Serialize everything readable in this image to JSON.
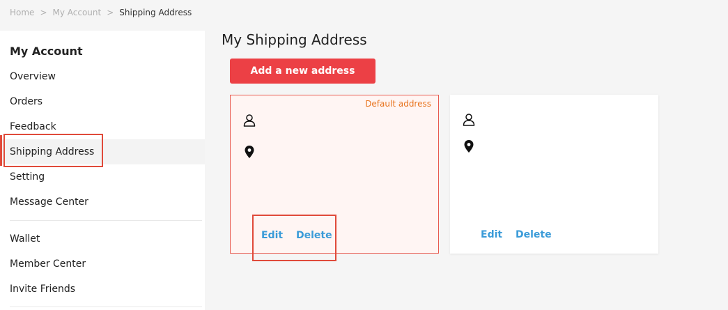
{
  "breadcrumb": {
    "items": [
      "Home",
      "My Account",
      "Shipping Address"
    ],
    "separator": ">"
  },
  "sidebar": {
    "title": "My Account",
    "items": [
      {
        "label": "Overview"
      },
      {
        "label": "Orders"
      },
      {
        "label": "Feedback"
      },
      {
        "label": "Shipping Address",
        "active": true
      },
      {
        "label": "Setting"
      },
      {
        "label": "Message Center"
      },
      {
        "label": "Wallet"
      },
      {
        "label": "Member Center"
      },
      {
        "label": "Invite Friends"
      }
    ]
  },
  "main": {
    "title": "My Shipping Address",
    "add_button_label": "Add a new address"
  },
  "addresses": [
    {
      "default_tag": "Default address",
      "icons": [
        "person-icon",
        "location-pin-icon"
      ],
      "edit_label": "Edit",
      "delete_label": "Delete"
    },
    {
      "icons": [
        "person-icon",
        "location-pin-icon"
      ],
      "edit_label": "Edit",
      "delete_label": "Delete"
    }
  ],
  "colors": {
    "accent": "#ec4045",
    "link": "#3a9bd8",
    "default_tag": "#e8731c",
    "highlight_box": "#e04a3a",
    "default_card_bg": "#fff5f3"
  }
}
